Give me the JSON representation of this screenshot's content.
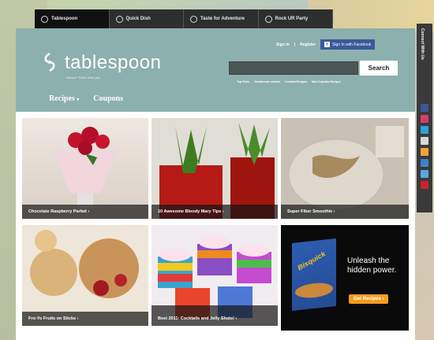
{
  "top_tabs": [
    {
      "label": "Tablespoon",
      "active": true
    },
    {
      "label": "Quick Dish",
      "active": false
    },
    {
      "label": "Taste for Adventure",
      "active": false
    },
    {
      "label": "Rock UR Party",
      "active": false
    }
  ],
  "header": {
    "logo_text": "tablespoon",
    "tagline": "Dinner? That's what you",
    "sign_in": "Sign In",
    "separator": "|",
    "register": "Register",
    "facebook_button": "Sign In with Facebook",
    "search_placeholder": "",
    "search_button": "Search",
    "quick_links": [
      "Top Picks",
      "Shortbread cookies",
      "Cocktail Recipes",
      "Mini Cupcake Recipes"
    ],
    "nav": [
      {
        "label": "Recipes",
        "has_dropdown": true
      },
      {
        "label": "Coupons",
        "has_dropdown": false
      }
    ]
  },
  "cards": [
    {
      "caption": "Chocolate Raspberry Parfait"
    },
    {
      "caption": "10 Awesome Bloody Mary Tips"
    },
    {
      "caption": "Super Fiber Smoothie"
    },
    {
      "caption": "Fro-Yo Fruits on Sticks"
    },
    {
      "caption": "Best 2011: Cocktails and Jelly Shots!"
    }
  ],
  "ad": {
    "headline": "Unleash the hidden power.",
    "button": "Get Recipes",
    "brand": "Bisquick"
  },
  "social": {
    "label": "Connect With Us",
    "icons": [
      "facebook-icon",
      "flickr-icon",
      "twitter-icon",
      "youtube-icon",
      "rss-icon",
      "delicious-icon",
      "email-icon",
      "pinterest-icon"
    ]
  },
  "colors": {
    "header_bg": "#8cb0ad",
    "topbar_bg": "#2d2f2e",
    "facebook": "#3b5998",
    "ad_button": "#f29c1f"
  }
}
